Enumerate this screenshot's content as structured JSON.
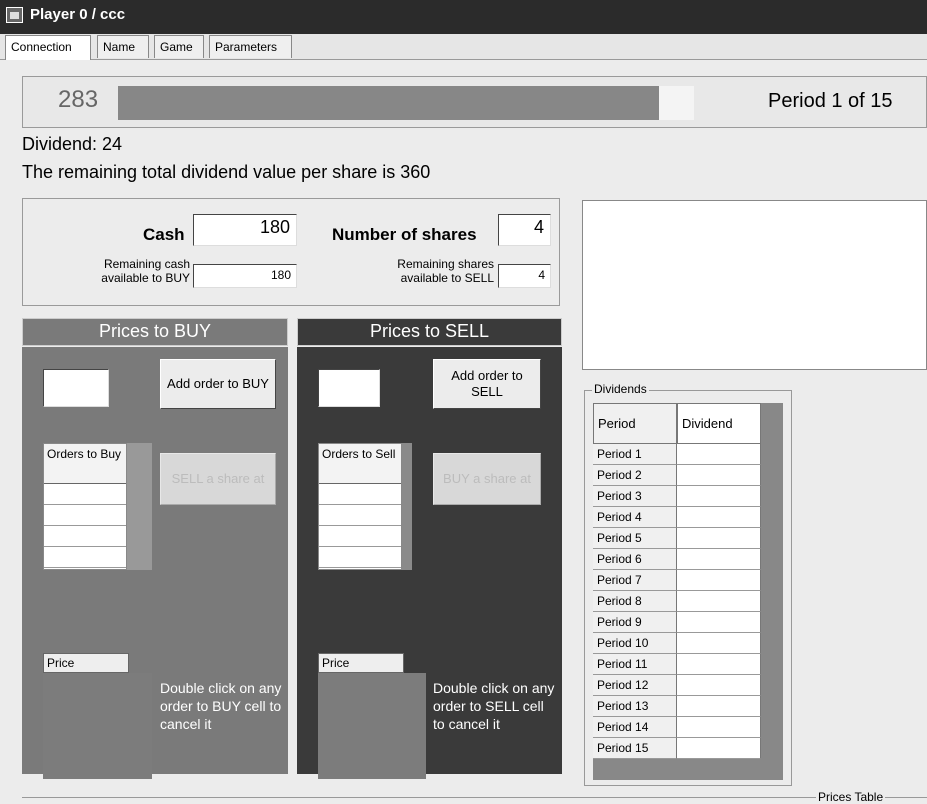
{
  "window": {
    "title": "Player 0 / ccc"
  },
  "tabs": [
    "Connection",
    "Name",
    "Game",
    "Parameters"
  ],
  "timer": {
    "seconds_left": "283",
    "progress_fraction": 0.94
  },
  "period": {
    "label": "Period 1 of 15"
  },
  "dividend": {
    "label": "Dividend: 24"
  },
  "remaining_dividend": {
    "text": "The remaining total dividend value per share is 360"
  },
  "account": {
    "cash_label": "Cash",
    "cash_value": "180",
    "remaining_cash_label": "Remaining cash available to BUY",
    "remaining_cash_value": "180",
    "shares_label": "Number of shares",
    "shares_value": "4",
    "remaining_shares_label": "Remaining shares available to SELL",
    "remaining_shares_value": "4"
  },
  "buy_panel": {
    "title": "Prices to BUY",
    "add_order_label": "Add order to BUY",
    "orders_header": "Orders to Buy",
    "sell_at_label": "SELL a share at",
    "price_header": "Price",
    "cancel_help": "Double click on any order to BUY cell to cancel it"
  },
  "sell_panel": {
    "title": "Prices to SELL",
    "add_order_label": "Add order to SELL",
    "orders_header": "Orders to Sell",
    "buy_at_label": "BUY a share at",
    "price_header": "Price",
    "cancel_help": "Double click on any order to SELL cell to cancel it"
  },
  "dividends_table": {
    "group_title": "Dividends",
    "col_period": "Period",
    "col_dividend": "Dividend",
    "rows": [
      "Period 1",
      "Period 2",
      "Period 3",
      "Period 4",
      "Period 5",
      "Period 6",
      "Period 7",
      "Period 8",
      "Period 9",
      "Period 10",
      "Period 11",
      "Period 12",
      "Period 13",
      "Period 14",
      "Period 15"
    ]
  },
  "prices_table": {
    "group_title": "Prices Table"
  },
  "colors": {
    "buy_panel": "#7a7a7a",
    "sell_panel": "#3a3a3a",
    "progress_fill": "#878787"
  }
}
